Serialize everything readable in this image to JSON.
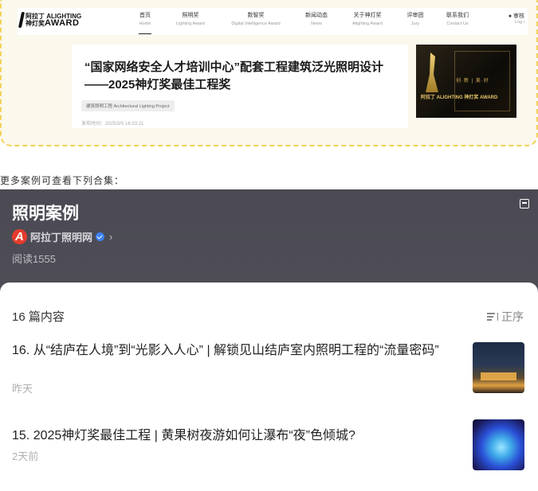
{
  "embed": {
    "logo": {
      "line1": "阿拉丁 ALIGHTING",
      "line2": "神灯奖",
      "award": "AWARD"
    },
    "nav": [
      {
        "zh": "首页",
        "en": "Home",
        "active": true
      },
      {
        "zh": "照明奖",
        "en": "Lighting Award"
      },
      {
        "zh": "数智奖",
        "en": "Digital Intelligence Award"
      },
      {
        "zh": "新闻动态",
        "en": "News"
      },
      {
        "zh": "关于神灯奖",
        "en": "Alighting Award"
      },
      {
        "zh": "评审团",
        "en": "Jury"
      },
      {
        "zh": "联系我们",
        "en": "Contact Us"
      }
    ],
    "user": {
      "zh": "审核",
      "en": "Log i"
    },
    "article": {
      "title": "“国家网络安全人才培训中心”配套工程建筑泛光照明设计——2025神灯奖最佳工程奖",
      "tag": "建筑照明工程 Architectural Lighting Project",
      "date": "发布时间：2025/3/5 16:33:21"
    },
    "poster": {
      "text": "阿拉丁 ALIGHTING 神灯奖 AWARD",
      "slogan": "创·新 | 美·好"
    }
  },
  "caption": "更多案例可查看下列合集：",
  "collection": {
    "title": "照明案例",
    "author": "阿拉丁照明网",
    "reads": "阅读1555"
  },
  "list": {
    "count": "16 篇内容",
    "sort_label": "正序",
    "items": [
      {
        "title": "16. 从“结庐在人境”到“光影入人心” | 解锁见山结庐室内照明工程的“流量密码”",
        "time": "昨天"
      },
      {
        "title": "15. 2025神灯奖最佳工程 | 黄果树夜游如何让瀑布“夜”色倾城?",
        "time": "2天前"
      }
    ]
  }
}
